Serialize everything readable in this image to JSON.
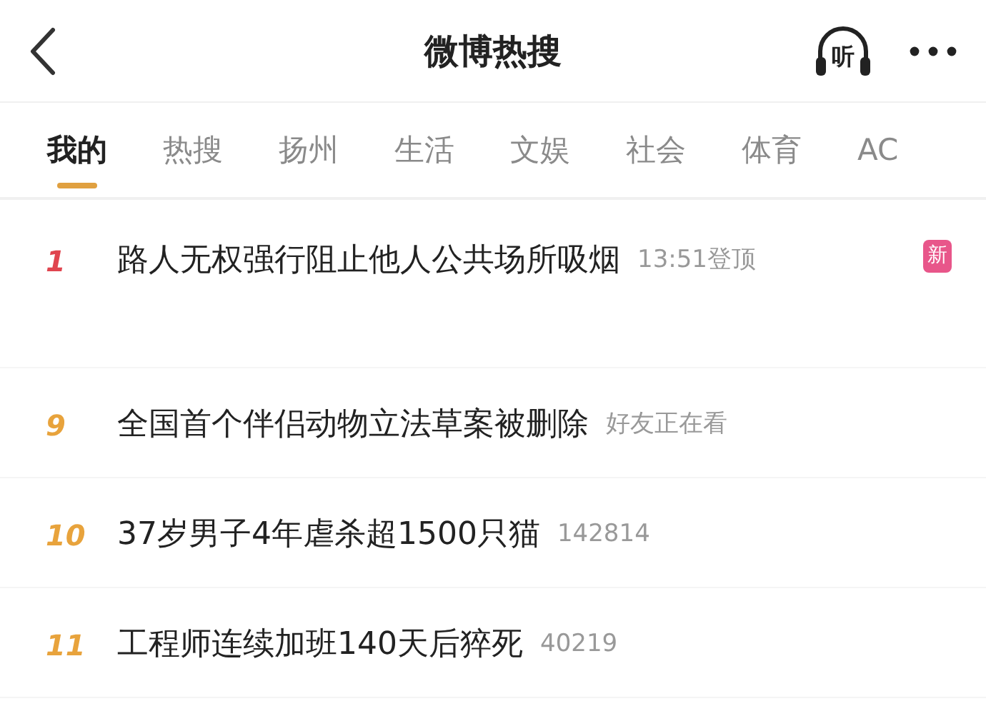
{
  "header": {
    "title": "微博热搜",
    "listen_label": "听"
  },
  "tabs": [
    {
      "label": "我的",
      "selected": true
    },
    {
      "label": "热搜",
      "selected": false
    },
    {
      "label": "扬州",
      "selected": false
    },
    {
      "label": "生活",
      "selected": false
    },
    {
      "label": "文娱",
      "selected": false
    },
    {
      "label": "社会",
      "selected": false
    },
    {
      "label": "体育",
      "selected": false
    },
    {
      "label": "AC",
      "selected": false
    }
  ],
  "rows": [
    {
      "rank": "1",
      "color": "#e0454f",
      "title": "路人无权强行阻止他人公共场所吸烟",
      "meta": "13:51登顶",
      "badge": "新"
    },
    {
      "rank": "9",
      "color": "#e8a33c",
      "title": "全国首个伴侣动物立法草案被删除",
      "meta": "好友正在看"
    },
    {
      "rank": "10",
      "color": "#e8a33c",
      "title": "37岁男子4年虐杀超1500只猫",
      "meta": "142814"
    },
    {
      "rank": "11",
      "color": "#e8a33c",
      "title": "工程师连续加班140天后猝死",
      "meta": "40219"
    }
  ]
}
